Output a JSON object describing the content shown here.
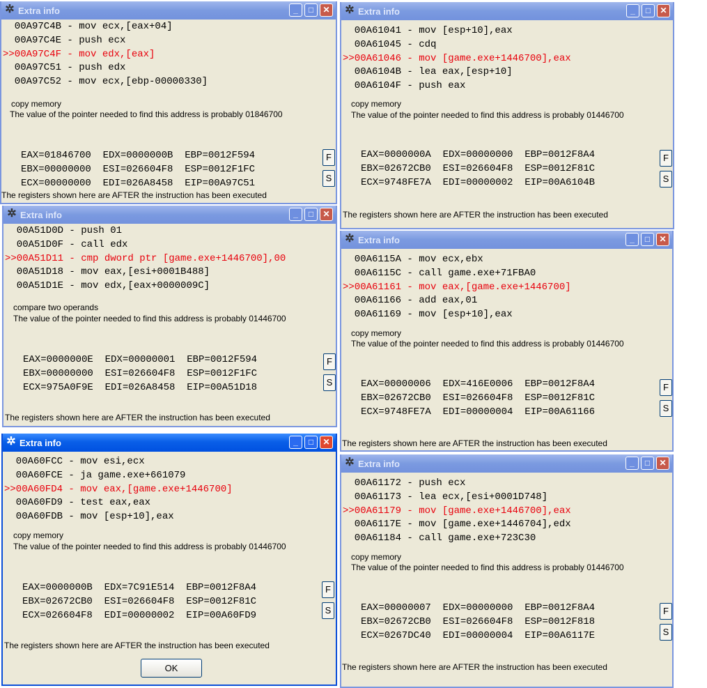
{
  "windows": [
    {
      "title": "Extra info",
      "icon": "cheat-engine-icon",
      "lines": [
        "  00A97C4B - mov ecx,[eax+04]",
        "  00A97C4E - push ecx",
        ">>00A97C4F - mov edx,[eax]",
        "  00A97C51 - push edx",
        "  00A97C52 - mov ecx,[ebp-00000330]"
      ],
      "desc": "copy memory",
      "pointer": "The value of the pointer needed to find this address is probably 01846700",
      "regs": [
        "EAX=01846700  EDX=0000000B  EBP=0012F594",
        "EBX=00000000  ESI=026604F8  ESP=0012F1FC",
        "ECX=00000000  EDI=026A8458  EIP=00A97C51"
      ],
      "f_label": "F",
      "s_label": "S",
      "note": "The registers shown here are AFTER the instruction has been executed"
    },
    {
      "title": "Extra info",
      "icon": "cheat-engine-icon",
      "lines": [
        "  00A51D0D - push 01",
        "  00A51D0F - call edx",
        ">>00A51D11 - cmp dword ptr [game.exe+1446700],00",
        "  00A51D18 - mov eax,[esi+0001B488]",
        "  00A51D1E - mov edx,[eax+0000009C]"
      ],
      "desc": "compare two operands",
      "pointer": "The value of the pointer needed to find this address is probably 01446700",
      "regs": [
        "EAX=0000000E  EDX=00000001  EBP=0012F594",
        "EBX=00000000  ESI=026604F8  ESP=0012F1FC",
        "ECX=975A0F9E  EDI=026A8458  EIP=00A51D18"
      ],
      "f_label": "F",
      "s_label": "S",
      "note": "The registers shown here are AFTER the instruction has been executed"
    },
    {
      "title": "Extra info",
      "icon": "cheat-engine-icon",
      "lines": [
        "  00A60FCC - mov esi,ecx",
        "  00A60FCE - ja game.exe+661079",
        ">>00A60FD4 - mov eax,[game.exe+1446700]",
        "  00A60FD9 - test eax,eax",
        "  00A60FDB - mov [esp+10],eax"
      ],
      "desc": "copy memory",
      "pointer": "The value of the pointer needed to find this address is probably 01446700",
      "regs": [
        "EAX=0000000B  EDX=7C91E514  EBP=0012F8A4",
        "EBX=02672CB0  ESI=026604F8  ESP=0012F81C",
        "ECX=026604F8  EDI=00000002  EIP=00A60FD9"
      ],
      "f_label": "F",
      "s_label": "S",
      "note": "The registers shown here are AFTER the instruction has been executed",
      "ok_label": "OK"
    },
    {
      "title": "Extra info",
      "icon": "cheat-engine-icon",
      "lines": [
        "  00A61041 - mov [esp+10],eax",
        "  00A61045 - cdq",
        ">>00A61046 - mov [game.exe+1446700],eax",
        "  00A6104B - lea eax,[esp+10]",
        "  00A6104F - push eax"
      ],
      "desc": "copy memory",
      "pointer": "The value of the pointer needed to find this address is probably 01446700",
      "regs": [
        "EAX=0000000A  EDX=00000000  EBP=0012F8A4",
        "EBX=02672CB0  ESI=026604F8  ESP=0012F81C",
        "ECX=9748FE7A  EDI=00000002  EIP=00A6104B"
      ],
      "f_label": "F",
      "s_label": "S",
      "note": "The registers shown here are AFTER the instruction has been executed"
    },
    {
      "title": "Extra info",
      "icon": "cheat-engine-icon",
      "lines": [
        "  00A6115A - mov ecx,ebx",
        "  00A6115C - call game.exe+71FBA0",
        ">>00A61161 - mov eax,[game.exe+1446700]",
        "  00A61166 - add eax,01",
        "  00A61169 - mov [esp+10],eax"
      ],
      "desc": "copy memory",
      "pointer": "The value of the pointer needed to find this address is probably 01446700",
      "regs": [
        "EAX=00000006  EDX=416E0006  EBP=0012F8A4",
        "EBX=02672CB0  ESI=026604F8  ESP=0012F81C",
        "ECX=9748FE7A  EDI=00000004  EIP=00A61166"
      ],
      "f_label": "F",
      "s_label": "S",
      "note": "The registers shown here are AFTER the instruction has been executed"
    },
    {
      "title": "Extra info",
      "icon": "cheat-engine-icon",
      "lines": [
        "  00A61172 - push ecx",
        "  00A61173 - lea ecx,[esi+0001D748]",
        ">>00A61179 - mov [game.exe+1446700],eax",
        "  00A6117E - mov [game.exe+1446704],edx",
        "  00A61184 - call game.exe+723C30"
      ],
      "desc": "copy memory",
      "pointer": "The value of the pointer needed to find this address is probably 01446700",
      "regs": [
        "EAX=00000007  EDX=00000000  EBP=0012F8A4",
        "EBX=02672CB0  ESI=026604F8  ESP=0012F818",
        "ECX=0267DC40  EDI=00000004  EIP=00A6117E"
      ],
      "f_label": "F",
      "s_label": "S",
      "note": "The registers shown here are AFTER the instruction has been executed"
    }
  ],
  "colors": {
    "highlight_line": "#e8000c",
    "active_title": "#0a5fe8",
    "inactive_title": "#7b9ae0",
    "window_bg": "#ece9d8"
  }
}
